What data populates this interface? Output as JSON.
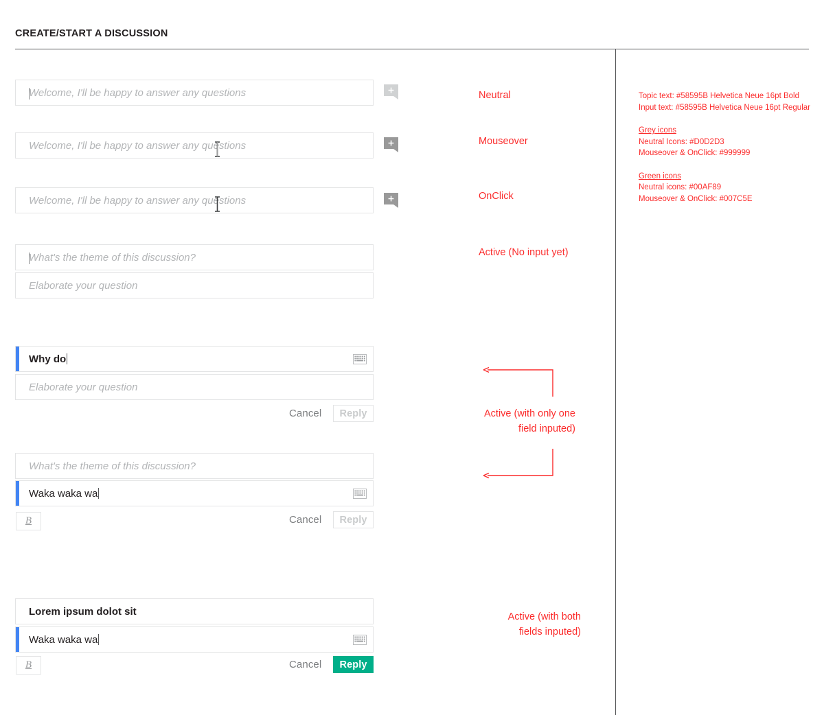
{
  "header": {
    "title": "CREATE/START A DISCUSSION"
  },
  "placeholders": {
    "welcome": "Welcome, I'll be happy to answer any questions",
    "theme": "What's the theme of this discussion?",
    "elaborate": "Elaborate your question"
  },
  "values": {
    "why_do": "Why do",
    "waka": "Waka waka wa",
    "lorem": "Lorem ipsum dolot sit"
  },
  "buttons": {
    "cancel": "Cancel",
    "reply": "Reply",
    "bold": "B",
    "plus": "+"
  },
  "icons": {
    "plus_neutral": "plus-bubble-icon",
    "plus_mouseover": "plus-bubble-icon",
    "plus_onclick": "plus-bubble-icon",
    "keyboard": "keyboard-icon",
    "cursor": "i-beam-cursor"
  },
  "annotations": [
    {
      "text": "Neutral"
    },
    {
      "text": "Mouseover"
    },
    {
      "text": "OnClick"
    },
    {
      "text": "Active (No input yet)"
    },
    {
      "line1": "Active (with only one",
      "line2": "field inputed)"
    },
    {
      "line1": "Active (with both",
      "line2": "fields inputed)"
    }
  ],
  "specs": {
    "topic_text": "Topic text: #58595B Helvetica Neue 16pt Bold",
    "input_text": "Input text: #58595B Helvetica Neue 16pt Regular",
    "grey_heading": "Grey icons",
    "grey_neutral": "Neutral Icons: #D0D2D3",
    "grey_hover": "Mouseover & OnClick: #999999",
    "green_heading": "Green icons",
    "green_neutral": "Neutral icons: #00AF89",
    "green_hover": "Mouseover & OnClick: #007C5E"
  },
  "colors": {
    "text": "#58595B",
    "icon_grey_neutral": "#D0D2D3",
    "icon_grey_hover": "#999999",
    "icon_green_neutral": "#00AF89",
    "icon_green_hover": "#007C5E",
    "annotation_red": "#FB2C2C",
    "active_accent": "#4285F4"
  }
}
